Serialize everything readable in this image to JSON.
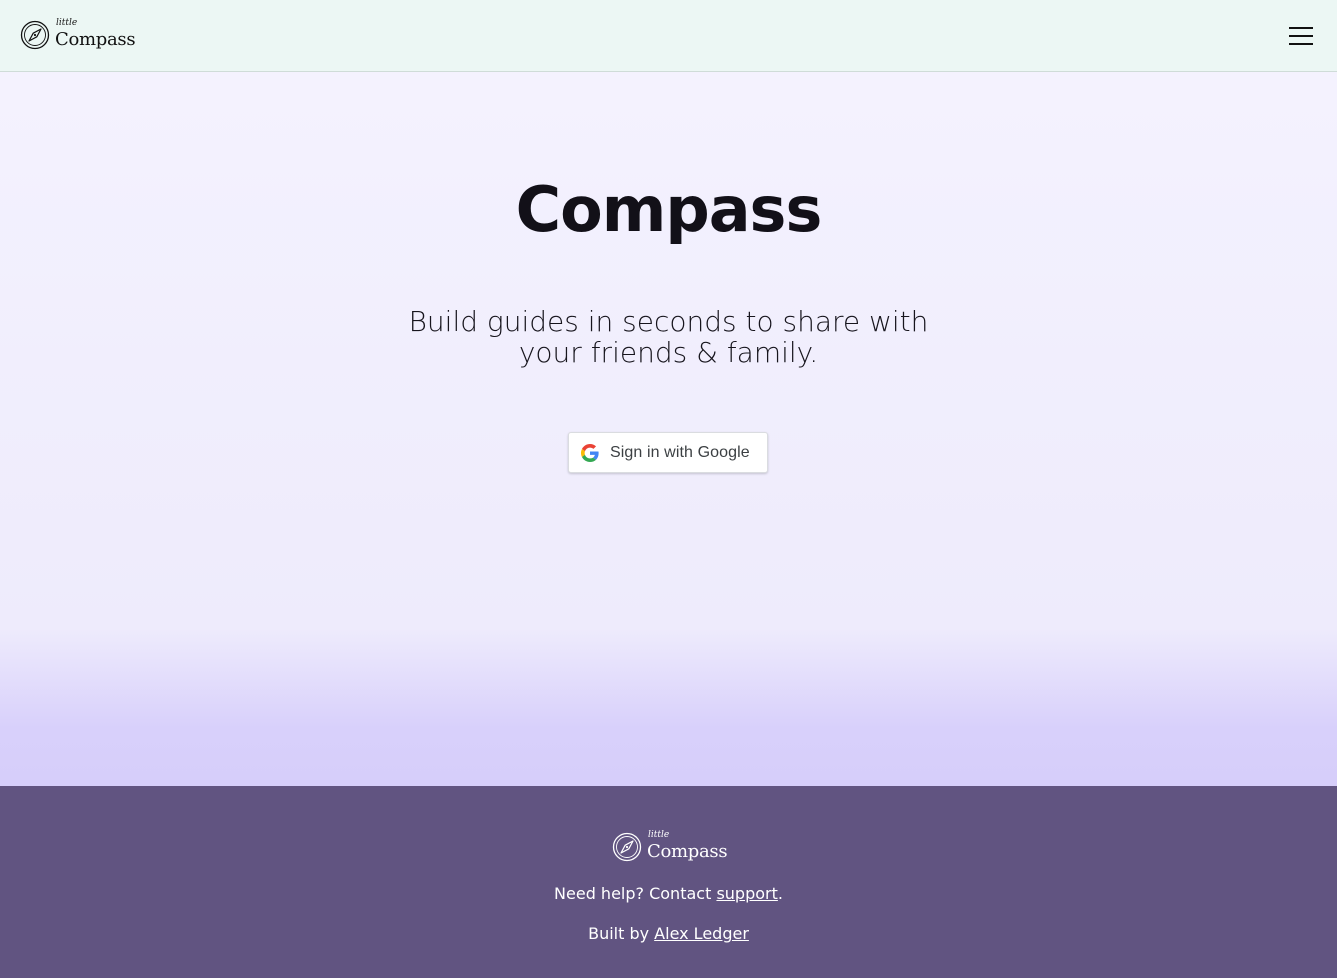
{
  "header": {
    "logo": {
      "small": "little",
      "main": "Compass",
      "icon": "compass-icon"
    },
    "menu_icon": "hamburger-menu-icon"
  },
  "hero": {
    "title": "Compass",
    "subtitle": "Build guides in seconds to share with your friends & family.",
    "signin_label": "Sign in with Google",
    "signin_icon": "google-icon"
  },
  "footer": {
    "logo": {
      "small": "little",
      "main": "Compass",
      "icon": "compass-icon"
    },
    "help_prefix": "Need help? Contact ",
    "help_link": "support",
    "help_suffix": ".",
    "built_prefix": "Built by ",
    "built_link": "Alex Ledger"
  },
  "colors": {
    "header_bg": "#ecf7f4",
    "hero_bg": "#f3f1fd",
    "footer_bg": "#615481",
    "text_dark": "#121018"
  }
}
